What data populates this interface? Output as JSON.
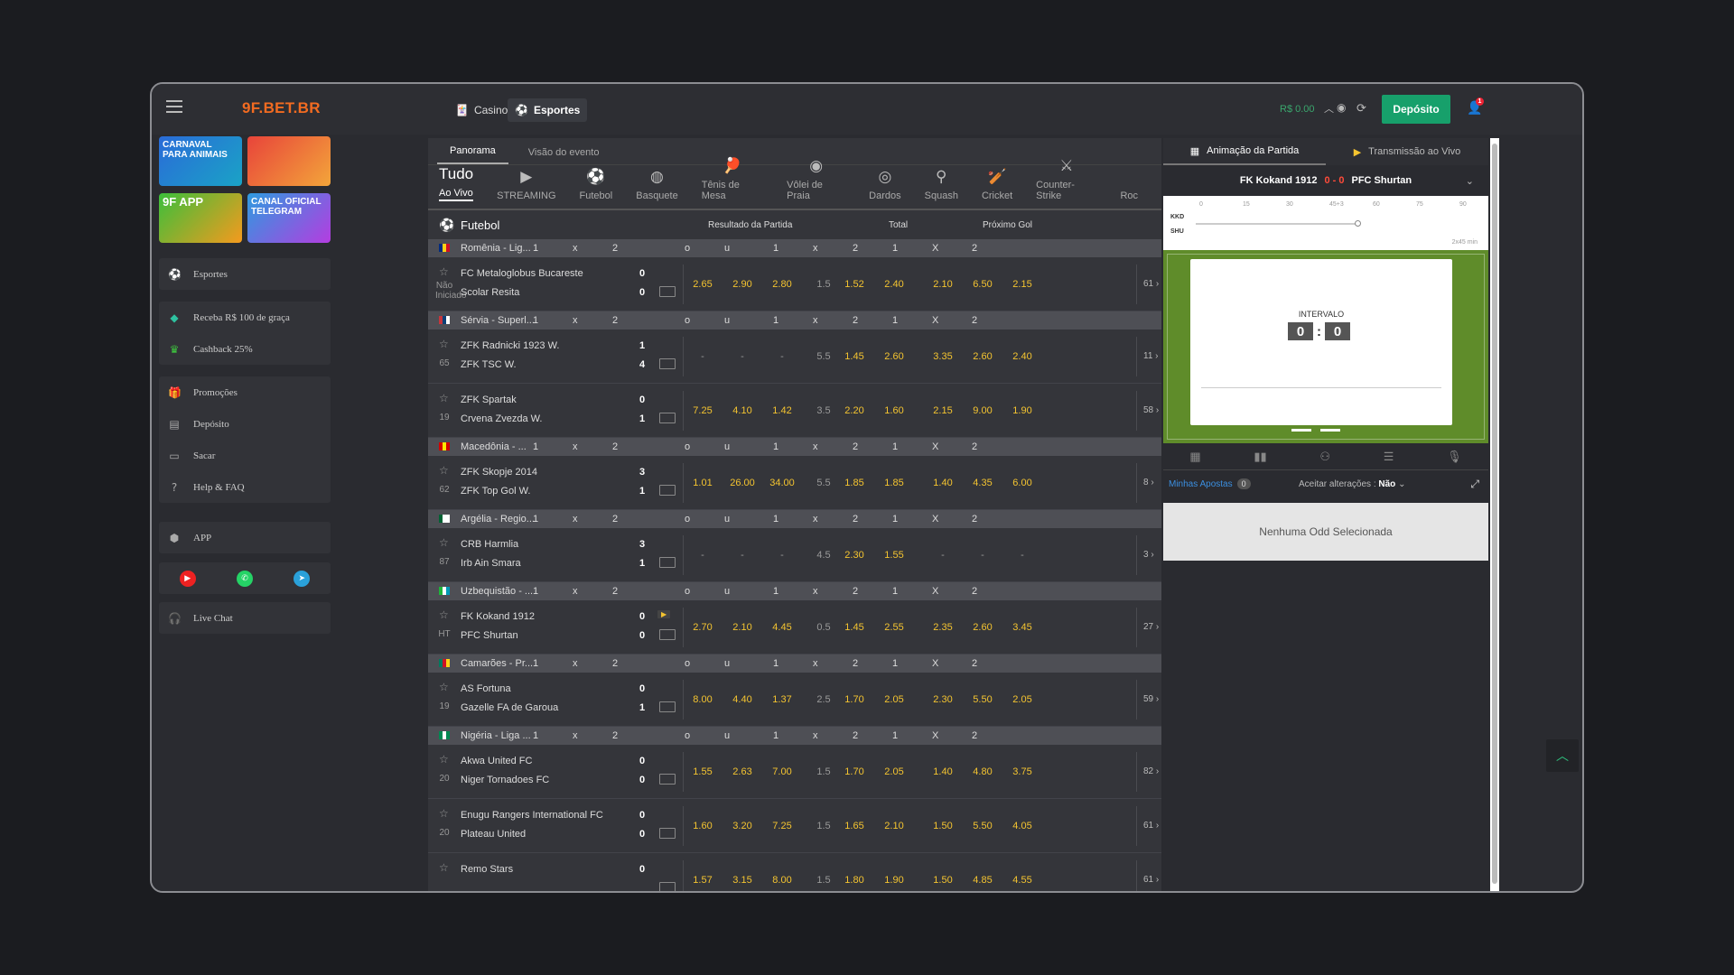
{
  "header": {
    "logo": "9F.BET.BR",
    "nav": [
      {
        "label": "Casino",
        "active": false
      },
      {
        "label": "Esportes",
        "active": true
      }
    ],
    "balance": "R$ 0.00",
    "deposit_label": "Depósito",
    "notif_count": "1"
  },
  "sidebar": {
    "banners": [
      "CARNAVAL PARA ANIMAIS",
      "",
      "9F APP",
      "CANAL OFICIAL TELEGRAM"
    ],
    "group1": [
      {
        "label": "Esportes",
        "icon": "soccer-icon"
      }
    ],
    "group2": [
      {
        "label": "Receba R$ 100 de graça",
        "icon": "diamond-icon"
      },
      {
        "label": "Cashback 25%",
        "icon": "crown-icon"
      }
    ],
    "group3": [
      {
        "label": "Promoções",
        "icon": "gift-icon"
      },
      {
        "label": "Depósito",
        "icon": "wallet-icon"
      },
      {
        "label": "Sacar",
        "icon": "card-icon"
      },
      {
        "label": "Help & FAQ",
        "icon": "help-icon"
      }
    ],
    "app": "APP",
    "social": [
      "youtube-icon",
      "whatsapp-icon",
      "telegram-icon"
    ],
    "live_chat": "Live Chat"
  },
  "main": {
    "tabs": [
      "Panorama",
      "Visão do evento"
    ],
    "sports": [
      {
        "label": "Ao Vivo",
        "big": "Tudo",
        "active": true
      },
      {
        "label": "STREAMING",
        "icon": "play-icon"
      },
      {
        "label": "Futebol",
        "icon": "soccer-icon"
      },
      {
        "label": "Basquete",
        "icon": "basketball-icon"
      },
      {
        "label": "Tênis de Mesa",
        "icon": "table-tennis-icon"
      },
      {
        "label": "Vôlei de Praia",
        "icon": "volleyball-icon"
      },
      {
        "label": "Dardos",
        "icon": "darts-icon"
      },
      {
        "label": "Squash",
        "icon": "squash-icon"
      },
      {
        "label": "Cricket",
        "icon": "cricket-icon"
      },
      {
        "label": "Counter-Strike",
        "icon": "cs-icon"
      },
      {
        "label": "Roc",
        "icon": ""
      }
    ],
    "section": "Futebol",
    "markets": [
      "Resultado da Partida",
      "Total",
      "Próximo Gol"
    ],
    "col_headers": [
      "1",
      "x",
      "2",
      "o",
      "u",
      "1",
      "x",
      "2",
      "1",
      "X",
      "2"
    ],
    "leagues": [
      {
        "name": "Romênia - Lig...",
        "flag": [
          "#002b7f",
          "#fcd116",
          "#ce1126"
        ],
        "matches": [
          {
            "home": "FC Metaloglobus Bucareste",
            "away": "Scolar Resita",
            "sh": "0",
            "sa": "0",
            "min": "Não Iniciado",
            "odds": [
              "2.65",
              "2.90",
              "2.80",
              "1.5",
              "1.52",
              "2.40",
              "2.10",
              "6.50",
              "2.15"
            ],
            "more": "61 ›"
          }
        ]
      },
      {
        "name": "Sérvia - Superl...",
        "flag": [
          "#c6363c",
          "#0c4076",
          "#ffffff"
        ],
        "matches": [
          {
            "home": "ZFK Radnicki 1923 W.",
            "away": "ZFK TSC W.",
            "sh": "1",
            "sa": "4",
            "min": "65",
            "odds": [
              "-",
              "-",
              "-",
              "5.5",
              "1.45",
              "2.60",
              "3.35",
              "2.60",
              "2.40"
            ],
            "more": "11 ›"
          },
          {
            "home": "ZFK Spartak",
            "away": "Crvena Zvezda W.",
            "sh": "0",
            "sa": "1",
            "min": "19",
            "odds": [
              "7.25",
              "4.10",
              "1.42",
              "3.5",
              "2.20",
              "1.60",
              "2.15",
              "9.00",
              "1.90"
            ],
            "more": "58 ›"
          }
        ]
      },
      {
        "name": "Macedônia - ...",
        "flag": [
          "#d20000",
          "#ffe600",
          "#d20000"
        ],
        "matches": [
          {
            "home": "ZFK Skopje 2014",
            "away": "ZFK Top Gol W.",
            "sh": "3",
            "sa": "1",
            "min": "62",
            "odds": [
              "1.01",
              "26.00",
              "34.00",
              "5.5",
              "1.85",
              "1.85",
              "1.40",
              "4.35",
              "6.00"
            ],
            "more": "8 ›"
          }
        ]
      },
      {
        "name": "Argélia - Regio...",
        "flag": [
          "#006233",
          "#ffffff",
          "#ffffff"
        ],
        "matches": [
          {
            "home": "CRB Harmlia",
            "away": "Irb Ain Smara",
            "sh": "3",
            "sa": "1",
            "min": "87",
            "odds": [
              "-",
              "-",
              "-",
              "4.5",
              "2.30",
              "1.55",
              "-",
              "-",
              "-"
            ],
            "more": "3 ›"
          }
        ]
      },
      {
        "name": "Uzbequistão - ...",
        "flag": [
          "#1eb53a",
          "#ffffff",
          "#0099b5"
        ],
        "matches": [
          {
            "home": "FK Kokand 1912",
            "away": "PFC Shurtan",
            "sh": "0",
            "sa": "0",
            "min": "HT",
            "odds": [
              "2.70",
              "2.10",
              "4.45",
              "0.5",
              "1.45",
              "2.55",
              "2.35",
              "2.60",
              "3.45"
            ],
            "more": "27 ›",
            "stream": true
          }
        ]
      },
      {
        "name": "Camarões - Pr...",
        "flag": [
          "#007a5e",
          "#ce1126",
          "#fcd116"
        ],
        "matches": [
          {
            "home": "AS Fortuna",
            "away": "Gazelle FA de Garoua",
            "sh": "0",
            "sa": "1",
            "min": "19",
            "odds": [
              "8.00",
              "4.40",
              "1.37",
              "2.5",
              "1.70",
              "2.05",
              "2.30",
              "5.50",
              "2.05"
            ],
            "more": "59 ›"
          }
        ]
      },
      {
        "name": "Nigéria - Liga ...",
        "flag": [
          "#008751",
          "#ffffff",
          "#008751"
        ],
        "matches": [
          {
            "home": "Akwa United FC",
            "away": "Niger Tornadoes FC",
            "sh": "0",
            "sa": "0",
            "min": "20",
            "odds": [
              "1.55",
              "2.63",
              "7.00",
              "1.5",
              "1.70",
              "2.05",
              "1.40",
              "4.80",
              "3.75"
            ],
            "more": "82 ›"
          },
          {
            "home": "Enugu Rangers International FC",
            "away": "Plateau United",
            "sh": "0",
            "sa": "0",
            "min": "20",
            "odds": [
              "1.60",
              "3.20",
              "7.25",
              "1.5",
              "1.65",
              "2.10",
              "1.50",
              "5.50",
              "4.05"
            ],
            "more": "61 ›"
          },
          {
            "home": "Remo Stars",
            "away": "",
            "sh": "0",
            "sa": "",
            "min": "",
            "odds": [
              "1.57",
              "3.15",
              "8.00",
              "1.5",
              "1.80",
              "1.90",
              "1.50",
              "4.85",
              "4.55"
            ],
            "more": "61 ›"
          }
        ]
      }
    ]
  },
  "right": {
    "tabs": [
      "Animação da Partida",
      "Transmissão ao Vivo"
    ],
    "home": "FK Kokand 1912",
    "away": "PFC Shurtan",
    "score": "0 - 0",
    "timeline_ticks": [
      "0",
      "15",
      "30",
      "45+3",
      "60",
      "75",
      "90"
    ],
    "timeline_teams": [
      "KKD",
      "SHU"
    ],
    "timeline_note": "2x45 min",
    "status": "INTERVALO",
    "score_home": "0",
    "score_away": "0",
    "my_bets": "Minhas Apostas",
    "my_bets_count": "0",
    "accept_label": "Aceitar alterações :",
    "accept_value": "Não",
    "empty": "Nenhuma Odd Selecionada"
  }
}
